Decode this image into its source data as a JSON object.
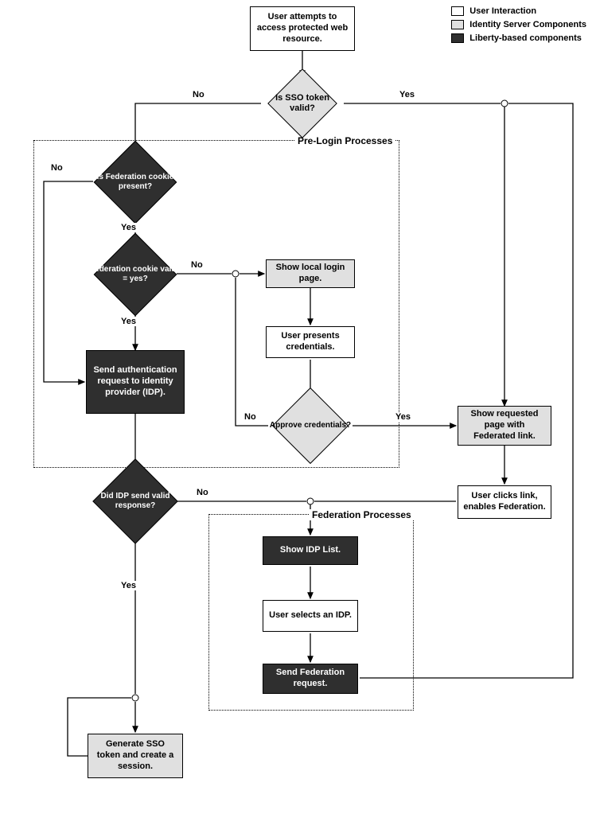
{
  "legend": {
    "user": "User Interaction",
    "identity": "Identity Server Components",
    "liberty": "Liberty-based components"
  },
  "nodes": {
    "start": "User attempts to access protected web resource.",
    "sso_valid": "Is SSO token valid?",
    "fed_present": "Is Federation cookie present?",
    "fed_value": "Federation cookie value = yes?",
    "send_auth": "Send authentication request to identity provider (IDP).",
    "show_login": "Show local login page.",
    "user_creds": "User presents credentials.",
    "approve": "Approve credentials?",
    "show_page": "Show requested page with Federated link.",
    "click_link": "User clicks link, enables Federation.",
    "idp_valid": "Did IDP send valid response?",
    "idp_list": "Show IDP List.",
    "select_idp": "User selects an IDP.",
    "send_fed": "Send Federation request.",
    "gen_token": "Generate SSO token and create a session."
  },
  "labels": {
    "yes": "Yes",
    "no": "No"
  },
  "groups": {
    "prelogin": "Pre-Login Processes",
    "federation": "Federation Processes"
  }
}
